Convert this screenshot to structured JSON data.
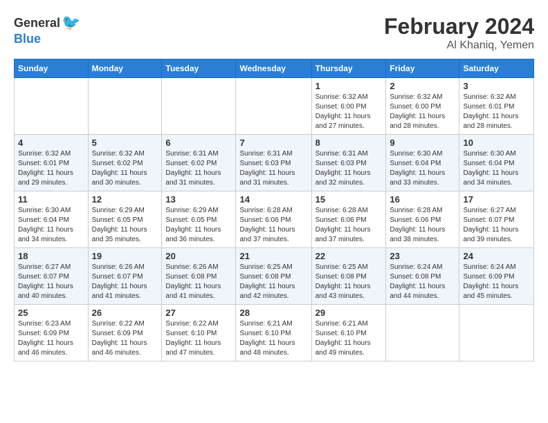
{
  "header": {
    "logo_general": "General",
    "logo_blue": "Blue",
    "title": "February 2024",
    "subtitle": "Al Khaniq, Yemen"
  },
  "columns": [
    "Sunday",
    "Monday",
    "Tuesday",
    "Wednesday",
    "Thursday",
    "Friday",
    "Saturday"
  ],
  "weeks": [
    [
      {
        "day": "",
        "empty": true
      },
      {
        "day": "",
        "empty": true
      },
      {
        "day": "",
        "empty": true
      },
      {
        "day": "",
        "empty": true
      },
      {
        "day": "1",
        "sunrise": "6:32 AM",
        "sunset": "6:00 PM",
        "daylight": "11 hours and 27 minutes."
      },
      {
        "day": "2",
        "sunrise": "6:32 AM",
        "sunset": "6:00 PM",
        "daylight": "11 hours and 28 minutes."
      },
      {
        "day": "3",
        "sunrise": "6:32 AM",
        "sunset": "6:01 PM",
        "daylight": "11 hours and 28 minutes."
      }
    ],
    [
      {
        "day": "4",
        "sunrise": "6:32 AM",
        "sunset": "6:01 PM",
        "daylight": "11 hours and 29 minutes."
      },
      {
        "day": "5",
        "sunrise": "6:32 AM",
        "sunset": "6:02 PM",
        "daylight": "11 hours and 30 minutes."
      },
      {
        "day": "6",
        "sunrise": "6:31 AM",
        "sunset": "6:02 PM",
        "daylight": "11 hours and 31 minutes."
      },
      {
        "day": "7",
        "sunrise": "6:31 AM",
        "sunset": "6:03 PM",
        "daylight": "11 hours and 31 minutes."
      },
      {
        "day": "8",
        "sunrise": "6:31 AM",
        "sunset": "6:03 PM",
        "daylight": "11 hours and 32 minutes."
      },
      {
        "day": "9",
        "sunrise": "6:30 AM",
        "sunset": "6:04 PM",
        "daylight": "11 hours and 33 minutes."
      },
      {
        "day": "10",
        "sunrise": "6:30 AM",
        "sunset": "6:04 PM",
        "daylight": "11 hours and 34 minutes."
      }
    ],
    [
      {
        "day": "11",
        "sunrise": "6:30 AM",
        "sunset": "6:04 PM",
        "daylight": "11 hours and 34 minutes."
      },
      {
        "day": "12",
        "sunrise": "6:29 AM",
        "sunset": "6:05 PM",
        "daylight": "11 hours and 35 minutes."
      },
      {
        "day": "13",
        "sunrise": "6:29 AM",
        "sunset": "6:05 PM",
        "daylight": "11 hours and 36 minutes."
      },
      {
        "day": "14",
        "sunrise": "6:28 AM",
        "sunset": "6:06 PM",
        "daylight": "11 hours and 37 minutes."
      },
      {
        "day": "15",
        "sunrise": "6:28 AM",
        "sunset": "6:06 PM",
        "daylight": "11 hours and 37 minutes."
      },
      {
        "day": "16",
        "sunrise": "6:28 AM",
        "sunset": "6:06 PM",
        "daylight": "11 hours and 38 minutes."
      },
      {
        "day": "17",
        "sunrise": "6:27 AM",
        "sunset": "6:07 PM",
        "daylight": "11 hours and 39 minutes."
      }
    ],
    [
      {
        "day": "18",
        "sunrise": "6:27 AM",
        "sunset": "6:07 PM",
        "daylight": "11 hours and 40 minutes."
      },
      {
        "day": "19",
        "sunrise": "6:26 AM",
        "sunset": "6:07 PM",
        "daylight": "11 hours and 41 minutes."
      },
      {
        "day": "20",
        "sunrise": "6:26 AM",
        "sunset": "6:08 PM",
        "daylight": "11 hours and 41 minutes."
      },
      {
        "day": "21",
        "sunrise": "6:25 AM",
        "sunset": "6:08 PM",
        "daylight": "11 hours and 42 minutes."
      },
      {
        "day": "22",
        "sunrise": "6:25 AM",
        "sunset": "6:08 PM",
        "daylight": "11 hours and 43 minutes."
      },
      {
        "day": "23",
        "sunrise": "6:24 AM",
        "sunset": "6:08 PM",
        "daylight": "11 hours and 44 minutes."
      },
      {
        "day": "24",
        "sunrise": "6:24 AM",
        "sunset": "6:09 PM",
        "daylight": "11 hours and 45 minutes."
      }
    ],
    [
      {
        "day": "25",
        "sunrise": "6:23 AM",
        "sunset": "6:09 PM",
        "daylight": "11 hours and 46 minutes."
      },
      {
        "day": "26",
        "sunrise": "6:22 AM",
        "sunset": "6:09 PM",
        "daylight": "11 hours and 46 minutes."
      },
      {
        "day": "27",
        "sunrise": "6:22 AM",
        "sunset": "6:10 PM",
        "daylight": "11 hours and 47 minutes."
      },
      {
        "day": "28",
        "sunrise": "6:21 AM",
        "sunset": "6:10 PM",
        "daylight": "11 hours and 48 minutes."
      },
      {
        "day": "29",
        "sunrise": "6:21 AM",
        "sunset": "6:10 PM",
        "daylight": "11 hours and 49 minutes."
      },
      {
        "day": "",
        "empty": true
      },
      {
        "day": "",
        "empty": true
      }
    ]
  ],
  "labels": {
    "sunrise": "Sunrise:",
    "sunset": "Sunset:",
    "daylight": "Daylight:"
  }
}
